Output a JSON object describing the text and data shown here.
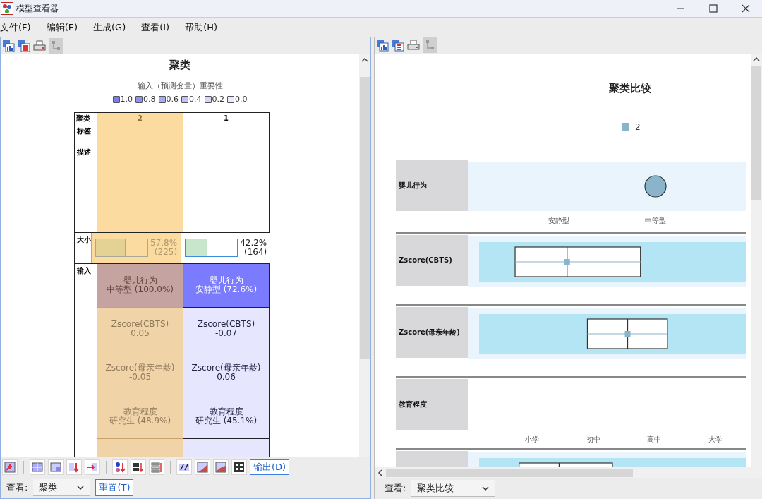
{
  "window": {
    "title": "模型查看器"
  },
  "menu": [
    "文件(F)",
    "编辑(E)",
    "生成(G)",
    "查看(I)",
    "帮助(H)"
  ],
  "left_view": {
    "title": "聚类",
    "legend": {
      "title": "输入（预测变量）重要性",
      "items": [
        {
          "label": "1.0",
          "color": "#7b7bf5"
        },
        {
          "label": "0.8",
          "color": "#9191f5"
        },
        {
          "label": "0.6",
          "color": "#a8a8f7"
        },
        {
          "label": "0.4",
          "color": "#bfbff9"
        },
        {
          "label": "0.2",
          "color": "#d5d5fb"
        },
        {
          "label": "0.0",
          "color": "#ebebfd"
        }
      ]
    },
    "table": {
      "header": "聚类",
      "clusters": [
        {
          "label": "2",
          "selected": true
        },
        {
          "label": "1",
          "selected": false
        }
      ],
      "row_labels": [
        "标签",
        "描述",
        "大小",
        "输入"
      ],
      "sizes": [
        {
          "level": 0.578,
          "percent": "57.8%",
          "count": "(225)"
        },
        {
          "level": 0.422,
          "percent": "42.2%",
          "count": "(164)"
        }
      ],
      "inputs": [
        [
          {
            "name": "婴儿行为",
            "value": "中等型 (100.0%)",
            "color": "#c4a3a0"
          },
          {
            "name": "婴儿行为",
            "value": "安静型 (72.6%)",
            "color": "#7b7bff"
          }
        ],
        [
          {
            "name": "Zscore(CBTS)",
            "value": "0.05",
            "color": "#f0d4a8"
          },
          {
            "name": "Zscore(CBTS)",
            "value": "-0.07",
            "color": "#e6e6ff"
          }
        ],
        [
          {
            "name": "Zscore(母亲年龄)",
            "value": "-0.05",
            "color": "#f0d4a8"
          },
          {
            "name": "Zscore(母亲年龄)",
            "value": "0.06",
            "color": "#e6e6ff"
          }
        ],
        [
          {
            "name": "教育程度",
            "value": "研究生 (48.9%)",
            "color": "#f0d4a8"
          },
          {
            "name": "教育程度",
            "value": "研究生 (45.1%)",
            "color": "#e6e6ff"
          }
        ],
        [
          {
            "color": "#f0d4a8"
          },
          {
            "color": "#e6e6ff"
          }
        ]
      ]
    },
    "output_button": "输出(D)",
    "view_label": "查看:",
    "view_value": "聚类",
    "reset_button": "重置(T)"
  },
  "right_view": {
    "title": "聚类比较",
    "legend": [
      {
        "label": "2",
        "color": "#8ab4cc"
      }
    ],
    "rows": [
      {
        "kind": "categorical",
        "label": "婴儿行为",
        "categories": [
          {
            "label": "安静型",
            "selected": false
          },
          {
            "label": "中等型",
            "selected": true
          }
        ]
      },
      {
        "kind": "boxplot",
        "label": "Zscore(CBTS)"
      },
      {
        "kind": "boxplot",
        "label": "Zscore(母亲年龄)"
      },
      {
        "kind": "categorical",
        "label": "教育程度",
        "categories": [
          {
            "label": "小学",
            "selected": false
          },
          {
            "label": "初中",
            "selected": false
          },
          {
            "label": "高中",
            "selected": false
          },
          {
            "label": "大学",
            "selected": false
          }
        ]
      },
      {
        "kind": "boxplot"
      }
    ],
    "view_label": "查看:",
    "view_value": "聚类比较"
  }
}
